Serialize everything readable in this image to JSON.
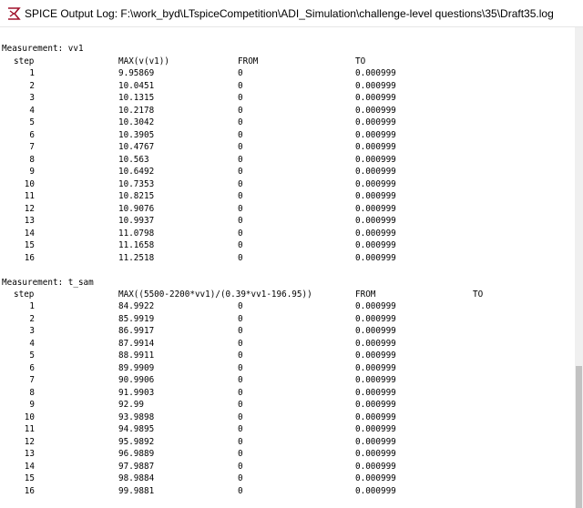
{
  "window": {
    "title": "SPICE Output Log: F:\\work_byd\\LTspiceCompetition\\ADI_Simulation\\challenge-level questions\\35\\Draft35.log",
    "icon": "ltspice-app-icon"
  },
  "log": {
    "measurements": [
      {
        "header": "Measurement: vv1",
        "columns": [
          "step",
          "MAX(v(v1))",
          "FROM",
          "TO"
        ],
        "rows": [
          [
            "1",
            "9.95869",
            "0",
            "0.000999"
          ],
          [
            "2",
            "10.0451",
            "0",
            "0.000999"
          ],
          [
            "3",
            "10.1315",
            "0",
            "0.000999"
          ],
          [
            "4",
            "10.2178",
            "0",
            "0.000999"
          ],
          [
            "5",
            "10.3042",
            "0",
            "0.000999"
          ],
          [
            "6",
            "10.3905",
            "0",
            "0.000999"
          ],
          [
            "7",
            "10.4767",
            "0",
            "0.000999"
          ],
          [
            "8",
            "10.563",
            "0",
            "0.000999"
          ],
          [
            "9",
            "10.6492",
            "0",
            "0.000999"
          ],
          [
            "10",
            "10.7353",
            "0",
            "0.000999"
          ],
          [
            "11",
            "10.8215",
            "0",
            "0.000999"
          ],
          [
            "12",
            "10.9076",
            "0",
            "0.000999"
          ],
          [
            "13",
            "10.9937",
            "0",
            "0.000999"
          ],
          [
            "14",
            "11.0798",
            "0",
            "0.000999"
          ],
          [
            "15",
            "11.1658",
            "0",
            "0.000999"
          ],
          [
            "16",
            "11.2518",
            "0",
            "0.000999"
          ]
        ]
      },
      {
        "header": "Measurement: t_sam",
        "columns": [
          "step",
          "MAX((5500-2200*vv1)/(0.39*vv1-196.95))",
          "FROM",
          "TO"
        ],
        "rows": [
          [
            "1",
            "84.9922",
            "0",
            "0.000999"
          ],
          [
            "2",
            "85.9919",
            "0",
            "0.000999"
          ],
          [
            "3",
            "86.9917",
            "0",
            "0.000999"
          ],
          [
            "4",
            "87.9914",
            "0",
            "0.000999"
          ],
          [
            "5",
            "88.9911",
            "0",
            "0.000999"
          ],
          [
            "6",
            "89.9909",
            "0",
            "0.000999"
          ],
          [
            "7",
            "90.9906",
            "0",
            "0.000999"
          ],
          [
            "8",
            "91.9903",
            "0",
            "0.000999"
          ],
          [
            "9",
            "92.99",
            "0",
            "0.000999"
          ],
          [
            "10",
            "93.9898",
            "0",
            "0.000999"
          ],
          [
            "11",
            "94.9895",
            "0",
            "0.000999"
          ],
          [
            "12",
            "95.9892",
            "0",
            "0.000999"
          ],
          [
            "13",
            "96.9889",
            "0",
            "0.000999"
          ],
          [
            "14",
            "97.9887",
            "0",
            "0.000999"
          ],
          [
            "15",
            "98.9884",
            "0",
            "0.000999"
          ],
          [
            "16",
            "99.9881",
            "0",
            "0.000999"
          ]
        ]
      }
    ]
  }
}
